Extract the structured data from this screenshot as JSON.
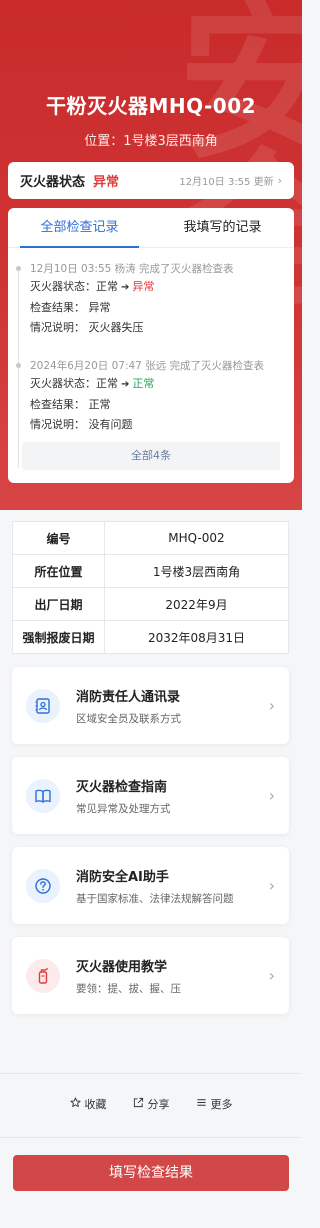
{
  "header": {
    "title": "干粉灭火器MHQ-002",
    "location": "位置：1号楼3层西南角",
    "watermark": "安全"
  },
  "status": {
    "label": "灭火器状态",
    "value": "异常",
    "update_text": "12月10日 3:55 更新"
  },
  "records": {
    "tabs": [
      {
        "label": "全部检查记录",
        "active": true
      },
      {
        "label": "我填写的记录",
        "active": false
      }
    ],
    "items": [
      {
        "meta": "12月10日 03:55  杨涛  完成了灭火器检查表",
        "status_label": "灭火器状态：",
        "from": "正常",
        "to": "异常",
        "result_label": "检查结果：",
        "result": "异常",
        "note_label": "情况说明：",
        "note": "灭火器失压"
      },
      {
        "meta": "2024年6月20日 07:47  张远  完成了灭火器检查表",
        "status_label": "灭火器状态：",
        "from": "正常",
        "to": "正常",
        "result_label": "检查结果：",
        "result": "正常",
        "note_label": "情况说明：",
        "note": "没有问题"
      }
    ],
    "more_label": "全部4条"
  },
  "info": {
    "rows": [
      {
        "key": "编号",
        "value": "MHQ-002"
      },
      {
        "key": "所在位置",
        "value": "1号楼3层西南角"
      },
      {
        "key": "出厂日期",
        "value": "2022年9月"
      },
      {
        "key": "强制报废日期",
        "value": "2032年08月31日"
      }
    ]
  },
  "menu": [
    {
      "title": "消防责任人通讯录",
      "desc": "区域安全员及联系方式",
      "icon": "contact-book-icon"
    },
    {
      "title": "灭火器检查指南",
      "desc": "常见异常及处理方式",
      "icon": "book-icon"
    },
    {
      "title": "消防安全AI助手",
      "desc": "基于国家标准、法律法规解答问题",
      "icon": "question-icon"
    },
    {
      "title": "灭火器使用教学",
      "desc": "要领：提、拔、握、压",
      "icon": "extinguisher-icon"
    }
  ],
  "actions": {
    "favorite": "收藏",
    "share": "分享",
    "more": "更多"
  },
  "submit_label": "填写检查结果",
  "colors": {
    "brand_red": "#cf3434",
    "accent_blue": "#2f6fd6",
    "abnormal": "#e33b3b",
    "normal": "#27a55a"
  }
}
